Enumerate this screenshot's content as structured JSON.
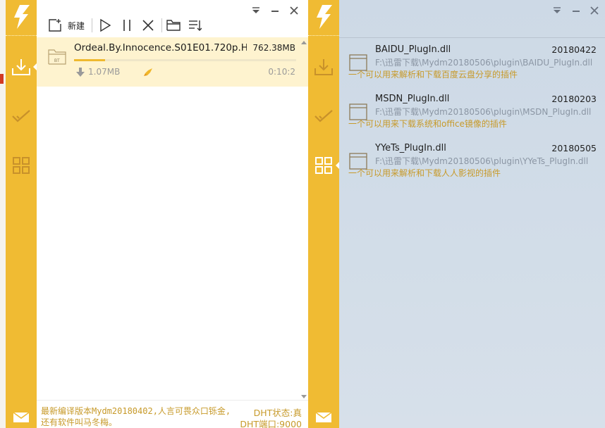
{
  "colors": {
    "accent": "#f0bb33",
    "highlight": "#fef3cf",
    "status_text": "#c79a2a",
    "plugin_bg": "#cdd9e6"
  },
  "toolbar": {
    "new_label": "新建",
    "icons": [
      "new-task-icon",
      "start-icon",
      "pause-icon",
      "delete-icon",
      "open-folder-icon",
      "sort-icon"
    ]
  },
  "window_controls": [
    "dropdown-icon",
    "minimize-icon",
    "close-icon"
  ],
  "sidebar": {
    "items": [
      {
        "name": "downloading",
        "icon": "download-icon"
      },
      {
        "name": "completed",
        "icon": "checkmark-icon"
      },
      {
        "name": "plugins",
        "icon": "grid-icon"
      }
    ],
    "bottom_icon": "mail-icon"
  },
  "download": {
    "name": "Ordeal.By.Innocence.S01E01.720p.H...",
    "size": "762.38MB",
    "speed": "1.07MB",
    "time_left": "0:10:2",
    "progress": 0.14,
    "file_badge": "BT"
  },
  "status": {
    "message": "最新编译版本Mydm20180402,人言可畏众口铄金,还有软件叫马冬梅。",
    "dht_state": "DHT状态:真",
    "dht_port": "DHT端口:9000"
  },
  "plugins": [
    {
      "name": "BAIDU_PlugIn.dll",
      "date": "20180422",
      "path": "F:\\迅雷下载\\Mydm20180506\\plugin\\BAIDU_PlugIn.dll",
      "desc": "一个可以用来解析和下载百度云盘分享的插件"
    },
    {
      "name": "MSDN_PlugIn.dll",
      "date": "20180203",
      "path": "F:\\迅雷下载\\Mydm20180506\\plugin\\MSDN_PlugIn.dll",
      "desc": "一个可以用来下载系统和office镜像的插件"
    },
    {
      "name": "YYeTs_PlugIn.dll",
      "date": "20180505",
      "path": "F:\\迅雷下载\\Mydm20180506\\plugin\\YYeTs_PlugIn.dll",
      "desc": "一个可以用来解析和下载人人影视的插件"
    }
  ]
}
